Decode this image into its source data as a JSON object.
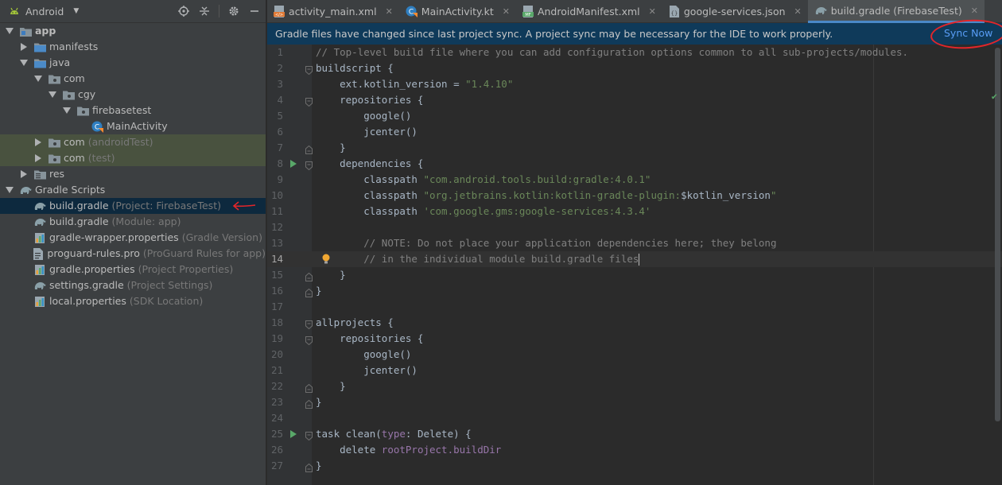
{
  "project_panel": {
    "selector_label": "Android",
    "tree": [
      {
        "label": "app",
        "hint": ""
      },
      {
        "label": "manifests",
        "hint": ""
      },
      {
        "label": "java",
        "hint": ""
      },
      {
        "label": "com",
        "hint": ""
      },
      {
        "label": "cgy",
        "hint": ""
      },
      {
        "label": "firebasetest",
        "hint": ""
      },
      {
        "label": "MainActivity",
        "hint": ""
      },
      {
        "label": "com",
        "hint": "(androidTest)"
      },
      {
        "label": "com",
        "hint": "(test)"
      },
      {
        "label": "res",
        "hint": ""
      },
      {
        "label": "Gradle Scripts",
        "hint": ""
      },
      {
        "label": "build.gradle",
        "hint": "(Project: FirebaseTest)"
      },
      {
        "label": "build.gradle",
        "hint": "(Module: app)"
      },
      {
        "label": "gradle-wrapper.properties",
        "hint": "(Gradle Version)"
      },
      {
        "label": "proguard-rules.pro",
        "hint": "(ProGuard Rules for app)"
      },
      {
        "label": "gradle.properties",
        "hint": "(Project Properties)"
      },
      {
        "label": "settings.gradle",
        "hint": "(Project Settings)"
      },
      {
        "label": "local.properties",
        "hint": "(SDK Location)"
      }
    ]
  },
  "tabs": [
    {
      "label": "activity_main.xml",
      "icon": "xml-file-icon"
    },
    {
      "label": "MainActivity.kt",
      "icon": "kotlin-class-icon"
    },
    {
      "label": "AndroidManifest.xml",
      "icon": "manifest-file-icon"
    },
    {
      "label": "google-services.json",
      "icon": "json-file-icon"
    },
    {
      "label": "build.gradle (FirebaseTest)",
      "icon": "gradle-icon"
    }
  ],
  "banner": {
    "message": "Gradle files have changed since last project sync. A project sync may be necessary for the IDE to work properly.",
    "action": "Sync Now"
  },
  "editor": {
    "current_line": 14,
    "lines": [
      {
        "n": "1",
        "text": "// Top-level build file where you can add configuration options common to all sub-projects/modules."
      },
      {
        "n": "2",
        "text": "buildscript {"
      },
      {
        "n": "3",
        "text": "    ext.kotlin_version = \"1.4.10\""
      },
      {
        "n": "4",
        "text": "    repositories {"
      },
      {
        "n": "5",
        "text": "        google()"
      },
      {
        "n": "6",
        "text": "        jcenter()"
      },
      {
        "n": "7",
        "text": "    }"
      },
      {
        "n": "8",
        "text": "    dependencies {"
      },
      {
        "n": "9",
        "text": "        classpath \"com.android.tools.build:gradle:4.0.1\""
      },
      {
        "n": "10",
        "text": "        classpath \"org.jetbrains.kotlin:kotlin-gradle-plugin:$kotlin_version\""
      },
      {
        "n": "11",
        "text": "        classpath 'com.google.gms:google-services:4.3.4'"
      },
      {
        "n": "12",
        "text": ""
      },
      {
        "n": "13",
        "text": "        // NOTE: Do not place your application dependencies here; they belong"
      },
      {
        "n": "14",
        "text": "        // in the individual module build.gradle files"
      },
      {
        "n": "15",
        "text": "    }"
      },
      {
        "n": "16",
        "text": "}"
      },
      {
        "n": "17",
        "text": ""
      },
      {
        "n": "18",
        "text": "allprojects {"
      },
      {
        "n": "19",
        "text": "    repositories {"
      },
      {
        "n": "20",
        "text": "        google()"
      },
      {
        "n": "21",
        "text": "        jcenter()"
      },
      {
        "n": "22",
        "text": "    }"
      },
      {
        "n": "23",
        "text": "}"
      },
      {
        "n": "24",
        "text": ""
      },
      {
        "n": "25",
        "text": "task clean(type: Delete) {"
      },
      {
        "n": "26",
        "text": "    delete rootProject.buildDir"
      },
      {
        "n": "27",
        "text": "}"
      }
    ]
  },
  "colors": {
    "accent": "#4a88c7",
    "sync_link": "#589df6",
    "annotation": "#e2262a",
    "string": "#6a8759",
    "comment": "#808080",
    "keyword": "#cc7832"
  }
}
